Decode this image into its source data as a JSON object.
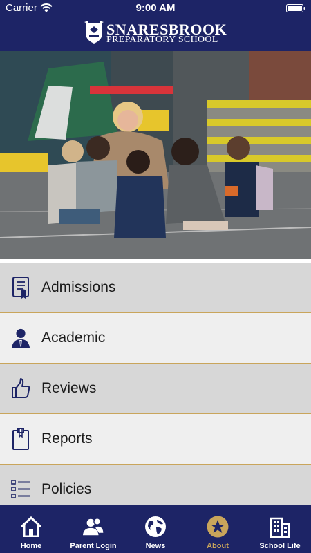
{
  "status_bar": {
    "carrier": "Carrier",
    "time": "9:00 AM",
    "wifi_icon": "wifi-icon",
    "battery_icon": "battery-icon"
  },
  "header": {
    "logo_line1": "SNARESBROOK",
    "logo_line2": "PREPARATORY SCHOOL",
    "logo_icon": "crest-icon",
    "background_color": "#1d2466"
  },
  "hero": {
    "image": "photo-teacher-with-children-in-playground"
  },
  "menu": {
    "items": [
      {
        "label": "Admissions",
        "icon": "certificate-icon"
      },
      {
        "label": "Academic",
        "icon": "person-icon"
      },
      {
        "label": "Reviews",
        "icon": "thumbs-up-icon"
      },
      {
        "label": "Reports",
        "icon": "clipboard-icon"
      },
      {
        "label": "Policies",
        "icon": "list-icon"
      }
    ],
    "divider_color": "#c9a55b"
  },
  "tabbar": {
    "tabs": [
      {
        "label": "Home",
        "icon": "home-icon",
        "active": false
      },
      {
        "label": "Parent Login",
        "icon": "people-icon",
        "active": false
      },
      {
        "label": "News",
        "icon": "globe-icon",
        "active": false
      },
      {
        "label": "About",
        "icon": "star-icon",
        "active": true
      },
      {
        "label": "School Life",
        "icon": "building-icon",
        "active": false
      }
    ],
    "active_color": "#c9a55b"
  }
}
